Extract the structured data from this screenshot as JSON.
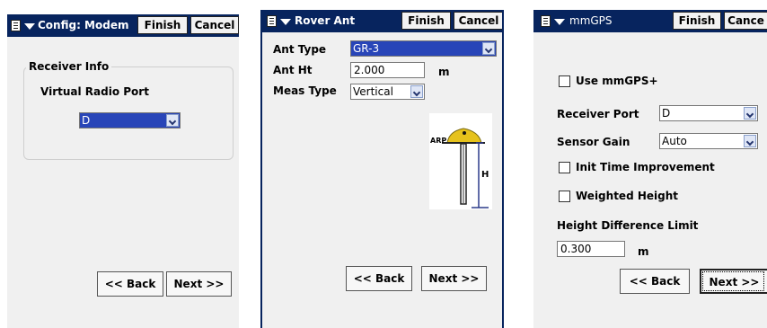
{
  "screens": [
    {
      "title": "Config: Modem",
      "finish": "Finish",
      "cancel": "Cancel",
      "group_title": "Receiver Info",
      "port_label": "Virtual Radio Port",
      "port_value": "D",
      "back": "<< Back",
      "next": "Next >>"
    },
    {
      "title": "Rover Ant",
      "finish": "Finish",
      "cancel": "Cancel",
      "ant_type_label": "Ant Type",
      "ant_type_value": "GR-3",
      "ant_ht_label": "Ant Ht",
      "ant_ht_value": "2.000",
      "ant_ht_unit": "m",
      "meas_type_label": "Meas Type",
      "meas_type_value": "Vertical",
      "diagram_arp": "ARP",
      "diagram_h": "H",
      "back": "<< Back",
      "next": "Next >>"
    },
    {
      "title": "mmGPS",
      "finish": "Finish",
      "cancel": "Cance",
      "use_mmgps_label": "Use mmGPS+",
      "use_mmgps_checked": false,
      "receiver_port_label": "Receiver Port",
      "receiver_port_value": "D",
      "sensor_gain_label": "Sensor Gain",
      "sensor_gain_value": "Auto",
      "init_time_label": "Init Time Improvement",
      "init_time_checked": false,
      "weighted_height_label": "Weighted Height",
      "weighted_height_checked": false,
      "height_diff_label": "Height Difference Limit",
      "height_diff_value": "0.300",
      "height_diff_unit": "m",
      "back": "<< Back",
      "next": "Next >>"
    }
  ],
  "colors": {
    "titlebar": "#07245e",
    "selection": "#2845b8",
    "panel": "#f0f0f0",
    "antenna": "#e6c21c"
  },
  "icons": [
    "menu-icon",
    "dropdown-arrow-icon",
    "chevron-down-icon",
    "antenna-icon"
  ]
}
